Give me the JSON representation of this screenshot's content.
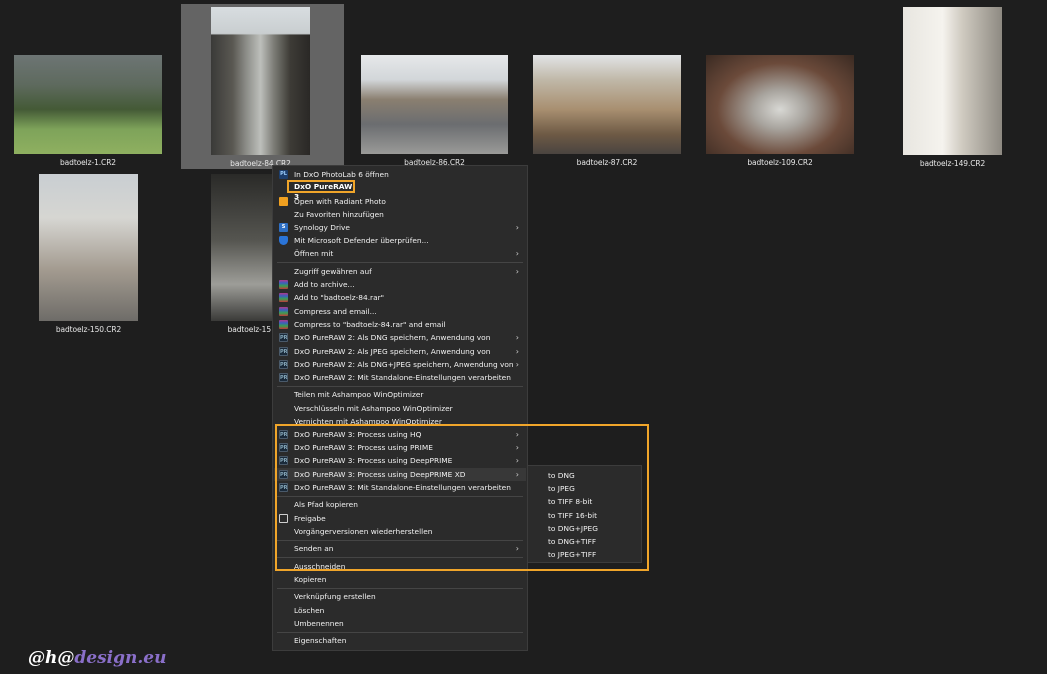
{
  "files": [
    {
      "name": "badtoelz-1.CR2"
    },
    {
      "name": "badtoelz-84.CR2"
    },
    {
      "name": "badtoelz-86.CR2"
    },
    {
      "name": "badtoelz-87.CR2"
    },
    {
      "name": "badtoelz-109.CR2"
    },
    {
      "name": "badtoelz-149.CR2"
    },
    {
      "name": "badtoelz-150.CR2"
    },
    {
      "name": "badtoelz-15"
    }
  ],
  "context_menu": {
    "items": [
      {
        "label": "In DxO PhotoLab 6 öffnen",
        "icon": "photolab-icon",
        "icon_text": "PL"
      },
      {
        "label": "DxO PureRAW 3",
        "highlighted": true
      },
      {
        "label": "Open with Radiant Photo",
        "icon": "radiant-photo-icon"
      },
      {
        "label": "Zu Favoriten hinzufügen"
      },
      {
        "label": "Synology Drive",
        "icon": "synology-drive-icon",
        "icon_text": "S"
      },
      {
        "label": "Mit Microsoft Defender überprüfen...",
        "icon": "defender-shield-icon"
      },
      {
        "label": "Öffnen mit"
      },
      {
        "label": "Zugriff gewähren auf"
      },
      {
        "label": "Add to archive...",
        "icon": "winrar-icon"
      },
      {
        "label": "Add to \"badtoelz-84.rar\"",
        "icon": "winrar-icon"
      },
      {
        "label": "Compress and email...",
        "icon": "winrar-icon"
      },
      {
        "label": "Compress to \"badtoelz-84.rar\" and email",
        "icon": "winrar-icon"
      },
      {
        "label": "DxO PureRAW 2: Als DNG speichern, Anwendung von",
        "icon": "pureraw-icon",
        "icon_text": "PR"
      },
      {
        "label": "DxO PureRAW 2: Als JPEG speichern, Anwendung von",
        "icon": "pureraw-icon",
        "icon_text": "PR"
      },
      {
        "label": "DxO PureRAW 2: Als DNG+JPEG speichern, Anwendung von",
        "icon": "pureraw-icon",
        "icon_text": "PR"
      },
      {
        "label": "DxO PureRAW 2: Mit Standalone-Einstellungen verarbeiten",
        "icon": "pureraw-icon",
        "icon_text": "PR"
      },
      {
        "label": "Teilen mit Ashampoo WinOptimizer"
      },
      {
        "label": "Verschlüsseln mit Ashampoo WinOptimizer"
      },
      {
        "label": "Vernichten mit Ashampoo WinOptimizer"
      },
      {
        "label": "DxO PureRAW 3: Process using HQ",
        "icon": "pureraw-icon",
        "icon_text": "PR"
      },
      {
        "label": "DxO PureRAW 3: Process using PRIME",
        "icon": "pureraw-icon",
        "icon_text": "PR"
      },
      {
        "label": "DxO PureRAW 3: Process using DeepPRIME",
        "icon": "pureraw-icon",
        "icon_text": "PR"
      },
      {
        "label": "DxO PureRAW 3: Process using DeepPRIME XD",
        "icon": "pureraw-icon",
        "icon_text": "PR"
      },
      {
        "label": "DxO PureRAW 3: Mit Standalone-Einstellungen verarbeiten",
        "icon": "pureraw-icon",
        "icon_text": "PR"
      },
      {
        "label": "Als Pfad kopieren"
      },
      {
        "label": "Freigabe",
        "icon": "share-icon"
      },
      {
        "label": "Vorgängerversionen wiederherstellen"
      },
      {
        "label": "Senden an"
      },
      {
        "label": "Ausschneiden"
      },
      {
        "label": "Kopieren"
      },
      {
        "label": "Verknüpfung erstellen"
      },
      {
        "label": "Löschen"
      },
      {
        "label": "Umbenennen"
      },
      {
        "label": "Eigenschaften"
      }
    ]
  },
  "submenu": {
    "items": [
      "to DNG",
      "to JPEG",
      "to TIFF 8-bit",
      "to TIFF 16-bit",
      "to DNG+JPEG",
      "to DNG+TIFF",
      "to JPEG+TIFF"
    ]
  },
  "watermark": {
    "prefix": "@h@",
    "suffix": "design.eu"
  },
  "colors": {
    "highlight": "#f0a52a",
    "menu_bg": "#2b2b2b",
    "background": "#1e1e1e",
    "watermark_accent": "#8a6fc9"
  }
}
